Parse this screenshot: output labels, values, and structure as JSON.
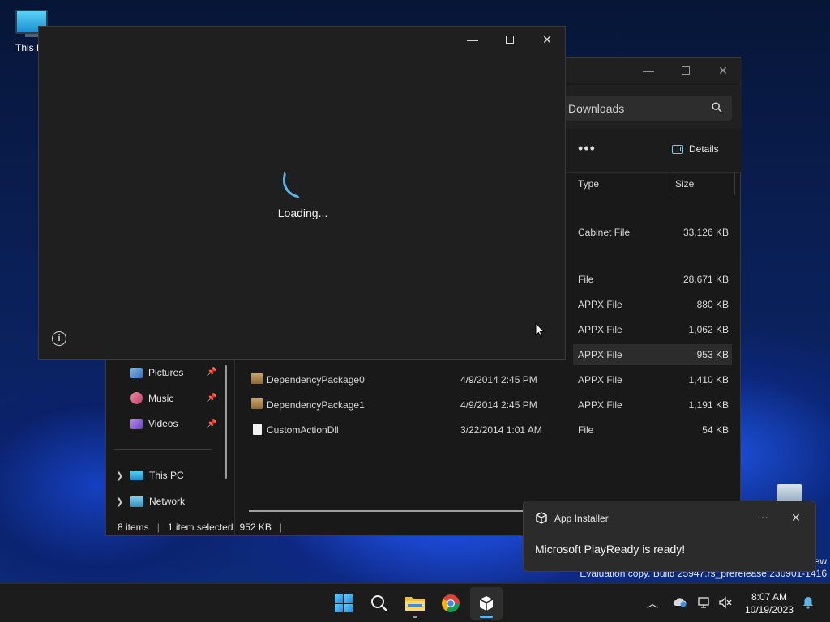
{
  "desktop": {
    "this_pc_label": "This P"
  },
  "explorer": {
    "search_text": "Downloads",
    "toolbar": {
      "more_label": "•••",
      "details_label": "Details"
    },
    "columns": {
      "type": "Type",
      "size": "Size"
    },
    "top_rows": [
      {
        "type": "Cabinet File",
        "size": "33,126 KB"
      },
      {
        "type": "File",
        "size": "28,671 KB"
      },
      {
        "type": "APPX File",
        "size": "880 KB"
      },
      {
        "type": "APPX File",
        "size": "1,062 KB"
      },
      {
        "type": "APPX File",
        "size": "953 KB"
      }
    ],
    "full_rows": [
      {
        "name": "DependencyPackage0",
        "date": "4/9/2014 2:45 PM",
        "type": "APPX File",
        "size": "1,410 KB"
      },
      {
        "name": "DependencyPackage1",
        "date": "4/9/2014 2:45 PM",
        "type": "APPX File",
        "size": "1,191 KB"
      },
      {
        "name": "CustomActionDll",
        "date": "3/22/2014 1:01 AM",
        "type": "File",
        "size": "54 KB"
      }
    ],
    "nav": {
      "pictures": "Pictures",
      "music": "Music",
      "videos": "Videos",
      "this_pc": "This PC",
      "network": "Network"
    },
    "status": {
      "items": "8 items",
      "selected": "1 item selected",
      "size": "952 KB"
    }
  },
  "installer": {
    "loading_text": "Loading..."
  },
  "toast": {
    "app_name": "App Installer",
    "more_label": "···",
    "message": "Microsoft PlayReady is ready!"
  },
  "watermark": {
    "line1": "ew",
    "line2": "Evaluation copy. Build 25947.rs_prerelease.230901-1416"
  },
  "taskbar": {
    "time": "8:07 AM",
    "date": "10/19/2023"
  },
  "colors": {
    "accent": "#5fb4e6",
    "taskbar_bg": "#1c1c1c",
    "window_bg": "#1f1f1f"
  }
}
